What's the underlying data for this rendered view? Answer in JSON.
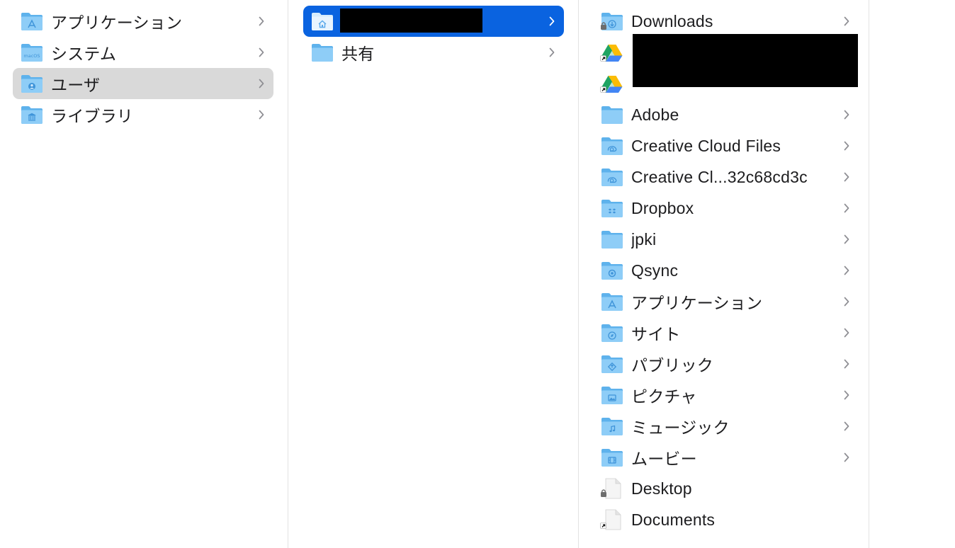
{
  "columns": [
    {
      "items": [
        {
          "label": "アプリケーション",
          "icon": "applications-folder-icon",
          "selected": ""
        },
        {
          "label": "システム",
          "icon": "macos-folder-icon",
          "selected": ""
        },
        {
          "label": "ユーザ",
          "icon": "users-folder-icon",
          "selected": "gray"
        },
        {
          "label": "ライブラリ",
          "icon": "library-folder-icon",
          "selected": ""
        }
      ]
    },
    {
      "items": [
        {
          "label": "",
          "icon": "home-folder-icon",
          "selected": "blue",
          "redacted": true
        },
        {
          "label": "共有",
          "icon": "folder-icon",
          "selected": ""
        }
      ]
    },
    {
      "items": [
        {
          "label": "Downloads",
          "icon": "downloads-folder-icon",
          "chevron": true
        },
        {
          "label": "",
          "icon": "google-drive-icon",
          "chevron": false,
          "redacted": true
        },
        {
          "label": "",
          "icon": "google-drive-icon",
          "chevron": false,
          "redacted": true
        },
        {
          "label": "Adobe",
          "icon": "folder-icon",
          "chevron": true
        },
        {
          "label": "Creative Cloud Files",
          "icon": "creative-cloud-folder-icon",
          "chevron": true
        },
        {
          "label": "Creative Cl...32c68cd3c",
          "icon": "creative-cloud-folder-icon",
          "chevron": true
        },
        {
          "label": "Dropbox",
          "icon": "dropbox-folder-icon",
          "chevron": true
        },
        {
          "label": "jpki",
          "icon": "folder-icon",
          "chevron": true
        },
        {
          "label": "Qsync",
          "icon": "qsync-folder-icon",
          "chevron": true
        },
        {
          "label": "アプリケーション",
          "icon": "applications-folder-icon",
          "chevron": true
        },
        {
          "label": "サイト",
          "icon": "sites-folder-icon",
          "chevron": true
        },
        {
          "label": "パブリック",
          "icon": "public-folder-icon",
          "chevron": true
        },
        {
          "label": "ピクチャ",
          "icon": "pictures-folder-icon",
          "chevron": true
        },
        {
          "label": "ミュージック",
          "icon": "music-folder-icon",
          "chevron": true
        },
        {
          "label": "ムービー",
          "icon": "movies-folder-icon",
          "chevron": true
        },
        {
          "label": "Desktop",
          "icon": "locked-document-icon",
          "chevron": false
        },
        {
          "label": "Documents",
          "icon": "alias-document-icon",
          "chevron": false
        }
      ]
    }
  ],
  "colors": {
    "selection_blue": "#0a63e0",
    "selection_gray": "#d9d9d9",
    "folder_light": "#8ecdf7",
    "folder_dark": "#5eb2ec",
    "glyph": "#3f94d9"
  }
}
